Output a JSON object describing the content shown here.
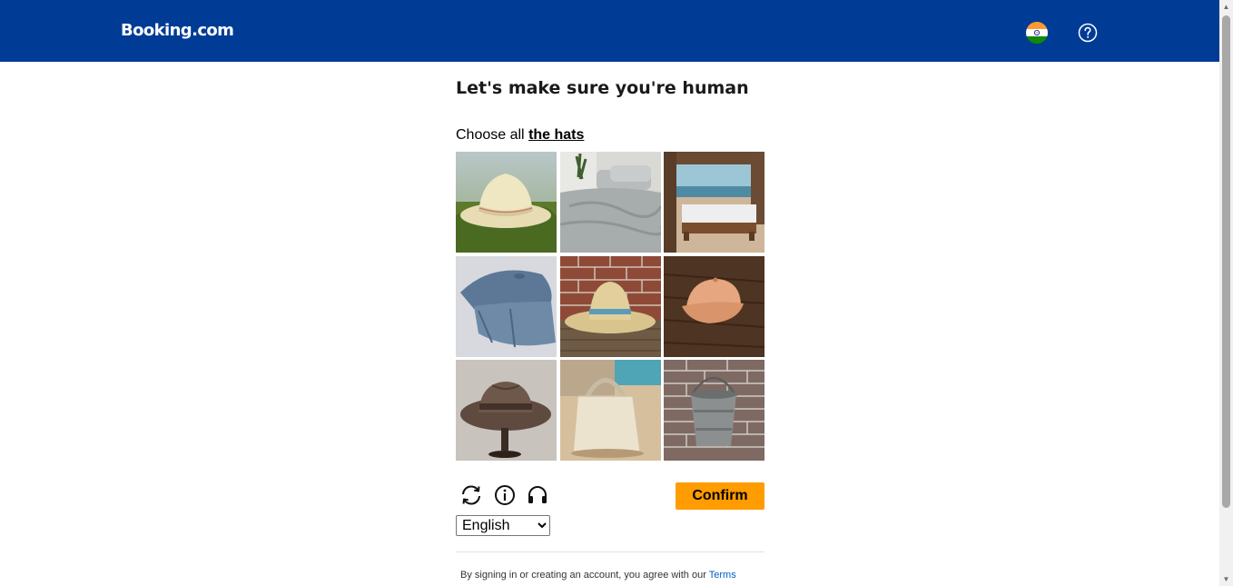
{
  "header": {
    "logo_text": "Booking.com",
    "background": "#003b95",
    "flag_icon": "india-flag-icon",
    "help_icon": "question-circle-icon"
  },
  "captcha": {
    "title": "Let's make sure you're human",
    "prompt_prefix": "Choose all",
    "prompt_target": "the hats",
    "tiles": [
      {
        "content": "straw hat on grass"
      },
      {
        "content": "gray bed with pillows"
      },
      {
        "content": "bed on beach"
      },
      {
        "content": "blue newsboy cap"
      },
      {
        "content": "straw hat with blue band"
      },
      {
        "content": "tan baseball cap"
      },
      {
        "content": "brown fedora hat"
      },
      {
        "content": "tote bag on beach"
      },
      {
        "content": "metal bucket"
      }
    ],
    "controls": {
      "refresh_icon": "refresh-icon",
      "info_icon": "info-icon",
      "audio_icon": "headphones-icon"
    },
    "confirm_label": "Confirm",
    "confirm_color": "#ff9c00",
    "language": {
      "selected": "English"
    }
  },
  "footer": {
    "legal_text": "By signing in or creating an account, you agree with our",
    "terms_link": "Terms",
    "link_color": "#0060c4"
  }
}
